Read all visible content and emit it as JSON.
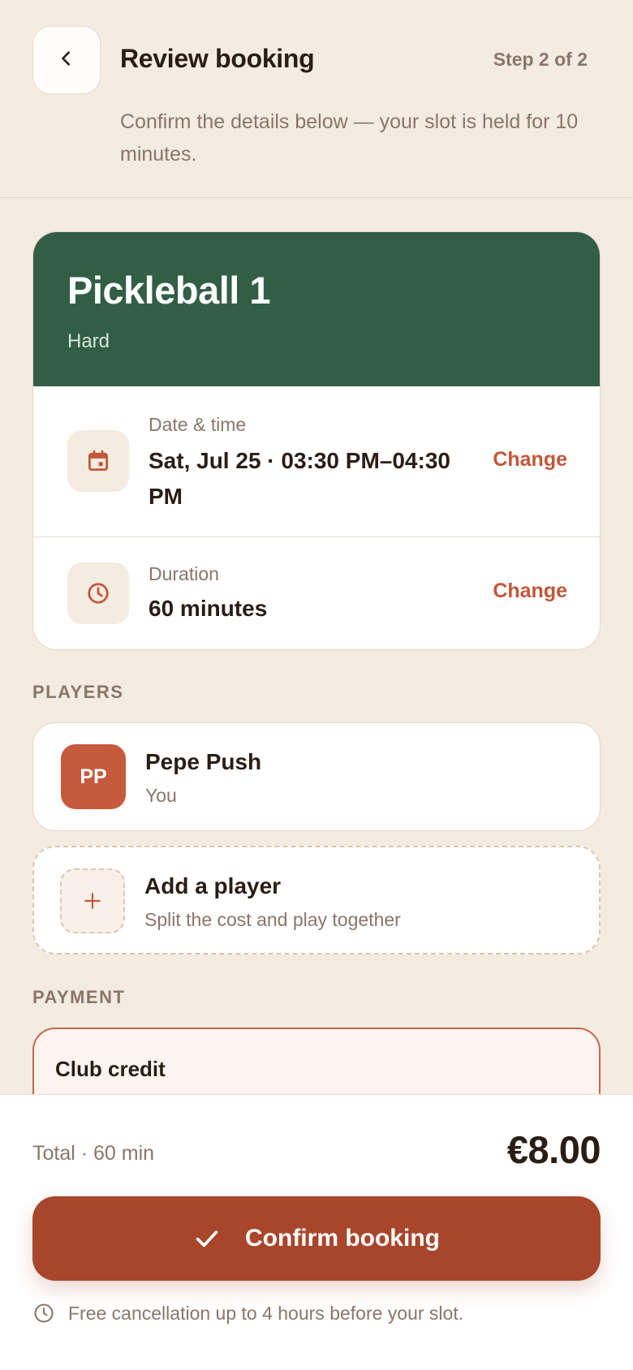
{
  "header": {
    "title": "Review booking",
    "step": "Step 2 of 2",
    "subtitle": "Confirm the details below — your slot is held for 10 minutes."
  },
  "court": {
    "name": "Pickleball 1",
    "surface": "Hard"
  },
  "details": {
    "datetime_label": "Date & time",
    "datetime_value": "Sat, Jul 25 · 03:30 PM–04:30 PM",
    "duration_label": "Duration",
    "duration_value": "60 minutes",
    "change_label": "Change"
  },
  "players": {
    "section_label": "PLAYERS",
    "items": [
      {
        "initials": "PP",
        "name": "Pepe Push",
        "role": "You"
      }
    ],
    "add_title": "Add a player",
    "add_subtitle": "Split the cost and play together"
  },
  "payment": {
    "section_label": "PAYMENT",
    "method": "Club credit"
  },
  "footer": {
    "total_label": "Total · 60 min",
    "total_amount": "€8.00",
    "confirm_label": "Confirm booking",
    "cancellation_note": "Free cancellation up to 4 hours before your slot."
  },
  "colors": {
    "background": "#f4ebe1",
    "court_header": "#325e45",
    "accent": "#c2573a",
    "confirm_button": "#a8462b",
    "avatar": "#c65a3d"
  },
  "icons": {
    "back": "chevron-left-icon",
    "date": "calendar-icon",
    "duration": "clock-icon",
    "add": "plus-icon",
    "confirm": "check-icon",
    "note": "clock-icon"
  }
}
